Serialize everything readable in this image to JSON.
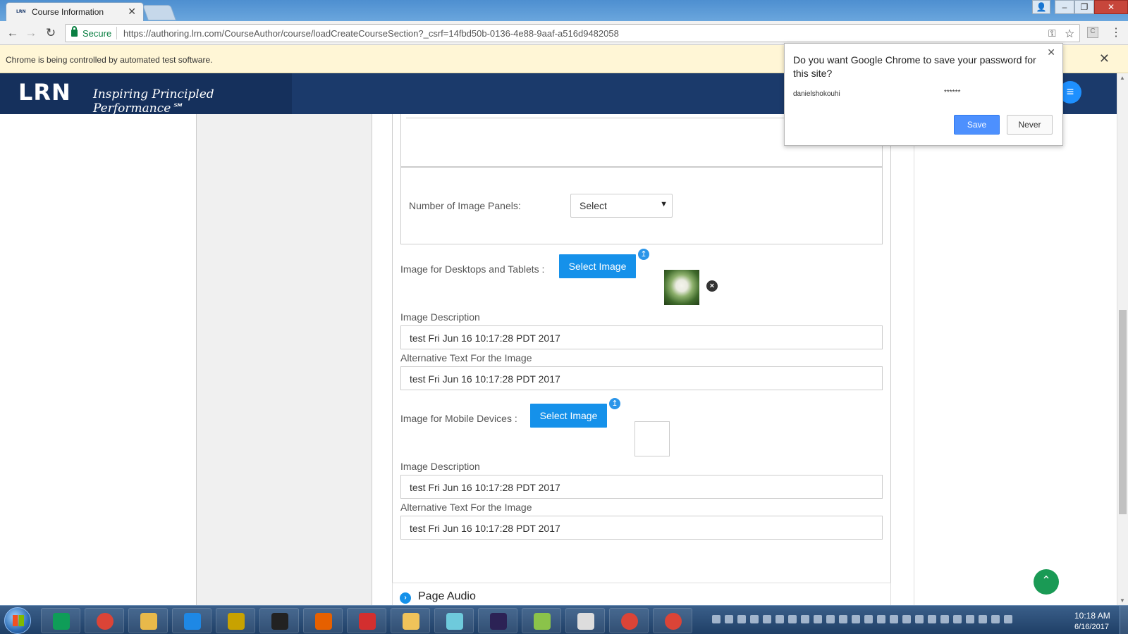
{
  "browser": {
    "tab_title": "Course Information",
    "tab_favicon": "LRN",
    "secure_label": "Secure",
    "url": "https://authoring.lrn.com/CourseAuthor/course/loadCreateCourseSection?_csrf=14fbd50b-0136-4e88-9aaf-a516d9482058",
    "infobar_text": "Chrome is being controlled by automated test software."
  },
  "header": {
    "logo": "LRN",
    "tagline": "Inspiring Principled Performance℠"
  },
  "form": {
    "image_panels_label": "Number of Image Panels:",
    "image_panels_select": "Select",
    "desktop_image_label": "Image for Desktops and Tablets :",
    "desktop_select_button": "Select Image",
    "desktop_description_label": "Image Description",
    "desktop_description_value": "test Fri Jun 16 10:17:28 PDT 2017",
    "desktop_alt_label": "Alternative Text For the Image",
    "desktop_alt_value": "test Fri Jun 16 10:17:28 PDT 2017",
    "mobile_image_label": "Image for Mobile Devices :",
    "mobile_select_button": "Select Image",
    "mobile_description_label": "Image Description",
    "mobile_description_value": "test Fri Jun 16 10:17:28 PDT 2017",
    "mobile_alt_label": "Alternative Text For the Image",
    "mobile_alt_value": "test Fri Jun 16 10:17:28 PDT 2017",
    "page_audio_label": "Page Audio"
  },
  "password_popup": {
    "title": "Do you want Google Chrome to save your password for this site?",
    "username": "danielshokouhi",
    "password_mask": "******",
    "save_label": "Save",
    "never_label": "Never"
  },
  "taskbar": {
    "time": "10:18 AM",
    "date": "6/16/2017",
    "apps": [
      "hangouts",
      "chrome",
      "file-explorer",
      "internet-explorer",
      "keepass",
      "command-prompt",
      "firefox",
      "vivaldi",
      "outlook",
      "slack",
      "eclipse",
      "notepad-plus",
      "writer",
      "chrome",
      "chrome"
    ],
    "app_colors": [
      "#0f9d58",
      "#db4437",
      "#e8b94a",
      "#1e88e5",
      "#c8a200",
      "#222222",
      "#e66000",
      "#d32f2f",
      "#f0c35a",
      "#6ecadc",
      "#2c2255",
      "#8bc34a",
      "#dddddd",
      "#db4437",
      "#db4437"
    ]
  },
  "colors": {
    "header_blue": "#1b3a6b",
    "button_blue": "#1591ea",
    "scroll_top_green": "#1a9a55",
    "infobar_yellow": "#fff6d6"
  }
}
